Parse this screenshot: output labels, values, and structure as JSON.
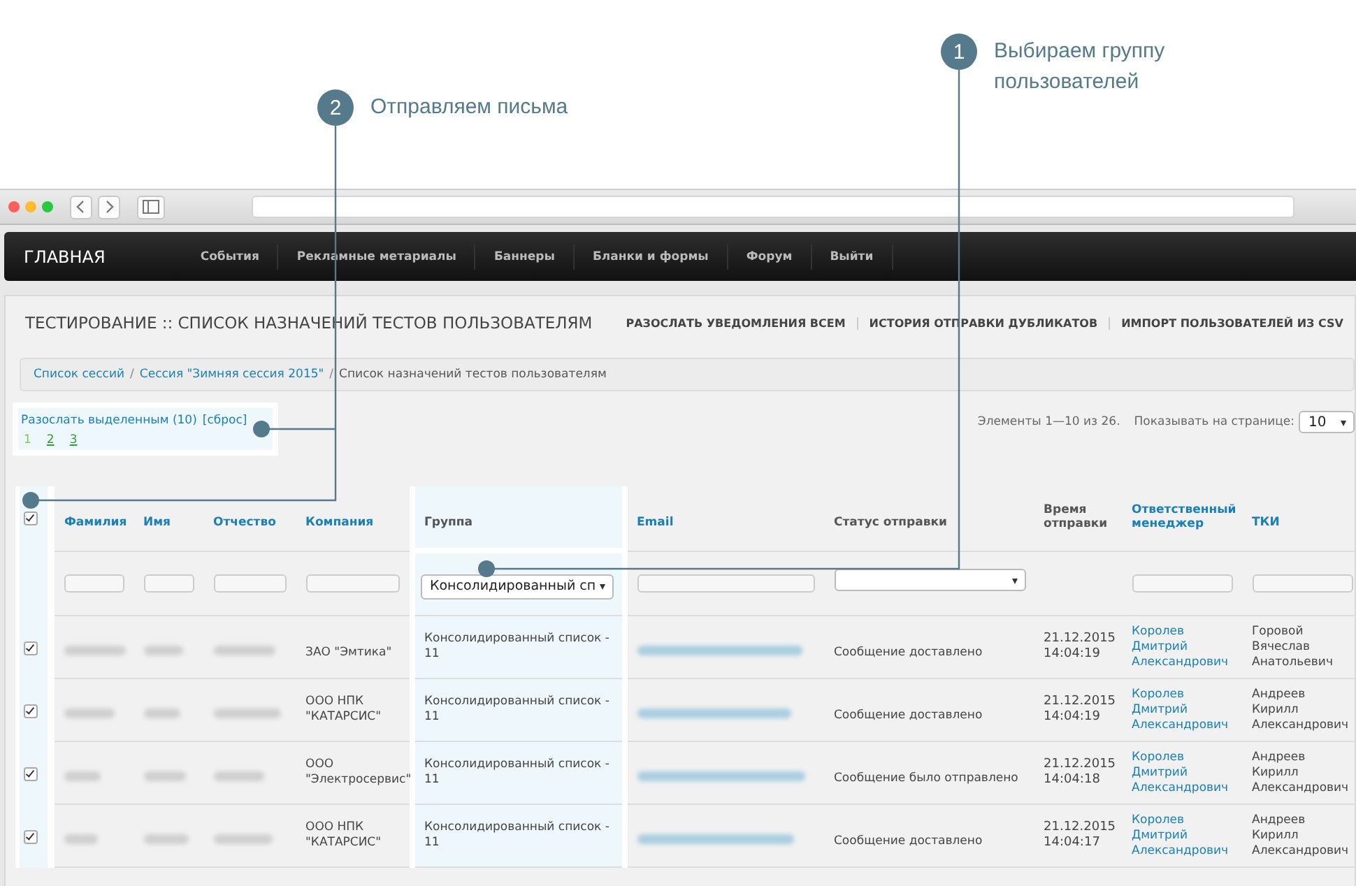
{
  "callouts": [
    {
      "number": "1",
      "text": "Выбираем группу пользователей"
    },
    {
      "number": "2",
      "text": "Отправляем письма"
    }
  ],
  "navbar": {
    "brand": "ГЛАВНАЯ",
    "items": [
      "События",
      "Рекламные метариалы",
      "Баннеры",
      "Бланки и формы",
      "Форум",
      "Выйти"
    ]
  },
  "page": {
    "title": "ТЕСТИРОВАНИЕ :: СПИСОК НАЗНАЧЕНИЙ ТЕСТОВ ПОЛЬЗОВАТЕЛЯМ",
    "actions": [
      "РАЗОСЛАТЬ УВЕДОМЛЕНИЯ ВСЕМ",
      "ИСТОРИЯ ОТПРАВКИ ДУБЛИКАТОВ",
      "ИМПОРТ ПОЛЬЗОВАТЕЛЕЙ ИЗ CSV"
    ]
  },
  "breadcrumb_separator": "/",
  "breadcrumbs": [
    {
      "label": "Список сессий",
      "link": true
    },
    {
      "label": "Сессия \"Зимняя сессия 2015\"",
      "link": true
    },
    {
      "label": "Список назначений тестов пользователям",
      "link": false
    }
  ],
  "bulk": {
    "send_link": "Разослать выделенным (10)",
    "reset_link": "[сброс]",
    "pages": [
      {
        "label": "1",
        "selected": true
      },
      {
        "label": "2",
        "selected": false
      },
      {
        "label": "3",
        "selected": false
      }
    ]
  },
  "summary": "Элементы 1—10 из 26.",
  "per_page": {
    "label": "Показывать на странице:",
    "value": "10"
  },
  "table": {
    "select_all_checked": true,
    "columns": [
      {
        "label": "Фамилия",
        "sortable": true
      },
      {
        "label": "Имя",
        "sortable": true
      },
      {
        "label": "Отчество",
        "sortable": true
      },
      {
        "label": "Компания",
        "sortable": true
      },
      {
        "label": "Группа",
        "sortable": false
      },
      {
        "label": "Email",
        "sortable": true
      },
      {
        "label": "Статус отправки",
        "sortable": false
      },
      {
        "label": "Время отправки",
        "sortable": false
      },
      {
        "label": "Ответственный менеджер",
        "sortable": true
      },
      {
        "label": "ТКИ",
        "sortable": true
      }
    ],
    "filters": [
      {
        "kind": "text"
      },
      {
        "kind": "text"
      },
      {
        "kind": "text"
      },
      {
        "kind": "text"
      },
      {
        "kind": "select",
        "value": "Консолидированный сп"
      },
      {
        "kind": "text"
      },
      {
        "kind": "select"
      },
      {
        "kind": "none"
      },
      {
        "kind": "text"
      },
      {
        "kind": "text"
      }
    ],
    "rows": [
      {
        "checked": true,
        "company": "ЗАО \"Эмтика\"",
        "group": "Консолидированный список - 11",
        "status": "Сообщение доставлено",
        "time": "21.12.2015 14:04:19",
        "manager": "Королев Дмитрий Александрович",
        "tki": "Горовой Вячеслав Анатольевич"
      },
      {
        "checked": true,
        "company": "ООО НПК \"КАТАРСИС\"",
        "group": "Консолидированный список - 11",
        "status": "Сообщение доставлено",
        "time": "21.12.2015 14:04:19",
        "manager": "Королев Дмитрий Александрович",
        "tki": "Андреев Кирилл Александрович"
      },
      {
        "checked": true,
        "company": "ООО \"Электросервис\"",
        "group": "Консолидированный список - 11",
        "status": "Сообщение было отправлено",
        "time": "21.12.2015 14:04:18",
        "manager": "Королев Дмитрий Александрович",
        "tki": "Андреев Кирилл Александрович"
      },
      {
        "checked": true,
        "company": "ООО НПК \"КАТАРСИС\"",
        "group": "Консолидированный список - 11",
        "status": "Сообщение доставлено",
        "time": "21.12.2015 14:04:17",
        "manager": "Королев Дмитрий Александрович",
        "tki": "Андреев Кирилл Александрович"
      }
    ]
  }
}
